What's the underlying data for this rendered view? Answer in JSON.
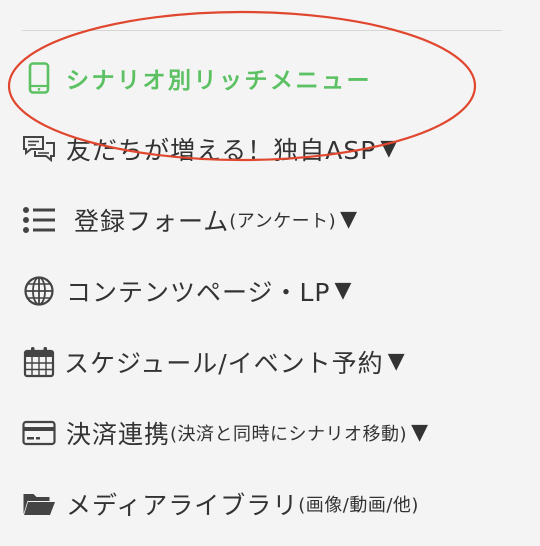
{
  "menu": {
    "items": [
      {
        "label": "シナリオ別リッチメニュー",
        "sub": "",
        "arrow": "",
        "icon": "smartphone-icon"
      },
      {
        "label": "友だちが増える！独自ASP",
        "sub": "",
        "arrow": "▼",
        "icon": "chat-bubbles-icon"
      },
      {
        "label": "登録フォーム",
        "sub": "(アンケート)",
        "arrow": "▼",
        "icon": "list-icon"
      },
      {
        "label": "コンテンツページ・LP",
        "sub": "",
        "arrow": "▼",
        "icon": "globe-icon"
      },
      {
        "label": "スケジュール/イベント予約",
        "sub": "",
        "arrow": "▼",
        "icon": "calendar-icon"
      },
      {
        "label": "決済連携",
        "sub": "(決済と同時にシナリオ移動)",
        "arrow": "▼",
        "icon": "credit-card-icon"
      },
      {
        "label": "メディアライブラリ",
        "sub": "(画像/動画/他)",
        "arrow": "",
        "icon": "folder-icon"
      }
    ]
  },
  "colors": {
    "active": "#5cc163",
    "text": "#333333",
    "highlight": "#e0472e",
    "background": "#f4f4f4"
  }
}
